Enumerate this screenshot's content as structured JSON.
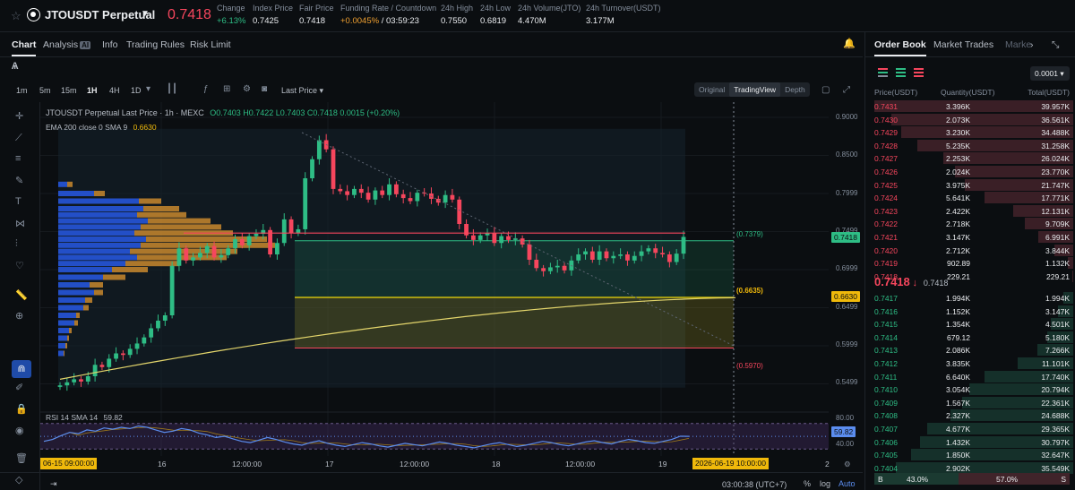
{
  "header": {
    "symbol": "JTOUSDT Perpetual",
    "last_price": "0.7418",
    "stats": [
      {
        "label": "Change",
        "value": "+6.13%",
        "tone": "green"
      },
      {
        "label": "Index Price",
        "value": "0.7425",
        "tone": ""
      },
      {
        "label": "Fair Price",
        "value": "0.7418",
        "tone": ""
      },
      {
        "label": "Funding Rate / Countdown",
        "value": "+0.0045%",
        "value2": " / 03:59:23",
        "tone": "orange"
      },
      {
        "label": "24h High",
        "value": "0.7550",
        "tone": ""
      },
      {
        "label": "24h Low",
        "value": "0.6819",
        "tone": ""
      },
      {
        "label": "24h Volume(JTO)",
        "value": "4.470M",
        "tone": ""
      },
      {
        "label": "24h Turnover(USDT)",
        "value": "3.177M",
        "tone": ""
      }
    ]
  },
  "tabs": {
    "chart": "Chart",
    "analysis": "Analysis",
    "analysis_badge": "AI",
    "info": "Info",
    "trading_rules": "Trading Rules",
    "risk_limit": "Risk Limit"
  },
  "toolbar": {
    "timeframes": [
      "1m",
      "5m",
      "15m",
      "1H",
      "4H",
      "1D"
    ],
    "active_timeframe": "1H",
    "price_source": "Last Price",
    "views": [
      "Original",
      "TradingView",
      "Depth"
    ],
    "active_view": "TradingView"
  },
  "chart": {
    "ohlc_title": "JTOUSDT Perpetual Last Price · 1h · MEXC",
    "ohlc_values": "O0.7403 H0.7422 L0.7403 C0.7418 0.0015 (+0.20%)",
    "ema_label": "EMA 200 close 0 SMA 9",
    "ema_value": "0.6630",
    "rsi_label": "RSI 14 SMA 14",
    "rsi_value": "59.82",
    "price_axis": [
      "0.9000",
      "0.8500",
      "0.7999",
      "0.7499",
      "0.6999",
      "0.6499",
      "0.5999",
      "0.5499"
    ],
    "price_tag_last": "0.7418",
    "price_tag_ema": "0.6630",
    "fib_levels": [
      {
        "label": "(0.7379)",
        "color": "#2ebd85"
      },
      {
        "label": "(0.6635)",
        "color": "#f0b90b"
      },
      {
        "label": "(0.5970)",
        "color": "#f6465d"
      }
    ],
    "rsi_axis": [
      "80.00",
      "40.00"
    ],
    "rsi_tag": "59.82",
    "time_axis": [
      "16",
      "12:00:00",
      "17",
      "12:00:00",
      "18",
      "12:00:00",
      "19"
    ],
    "time_tag_left": "06-15   09:00:00",
    "time_tag_right": "2026-06-19   10:00:00",
    "time_axis_end": "2"
  },
  "chart_data": {
    "type": "candlestick",
    "title": "JTOUSDT Perpetual Last Price · 1h · MEXC",
    "ylim": [
      0.52,
      0.92
    ],
    "close": [
      0.548,
      0.552,
      0.556,
      0.553,
      0.56,
      0.575,
      0.572,
      0.583,
      0.59,
      0.588,
      0.596,
      0.603,
      0.611,
      0.623,
      0.633,
      0.64,
      0.705,
      0.728,
      0.712,
      0.716,
      0.722,
      0.731,
      0.716,
      0.719,
      0.728,
      0.74,
      0.732,
      0.744,
      0.747,
      0.752,
      0.72,
      0.735,
      0.766,
      0.748,
      0.753,
      0.82,
      0.845,
      0.87,
      0.858,
      0.806,
      0.803,
      0.798,
      0.806,
      0.801,
      0.792,
      0.804,
      0.798,
      0.812,
      0.799,
      0.794,
      0.79,
      0.801,
      0.8,
      0.793,
      0.788,
      0.798,
      0.792,
      0.76,
      0.745,
      0.739,
      0.745,
      0.748,
      0.735,
      0.744,
      0.739,
      0.741,
      0.733,
      0.713,
      0.702,
      0.698,
      0.703,
      0.705,
      0.699,
      0.712,
      0.72,
      0.724,
      0.713,
      0.724,
      0.715,
      0.718,
      0.72,
      0.712,
      0.718,
      0.724,
      0.728,
      0.722,
      0.72,
      0.71,
      0.721,
      0.743
    ],
    "ema200": "rising from 0.556 to 0.663"
  },
  "order_book": {
    "tabs": [
      "Order Book",
      "Market Trades",
      "Marke"
    ],
    "precision": "0.0001",
    "columns": [
      "Price(USDT)",
      "Quantity(USDT)",
      "Total(USDT)"
    ],
    "asks": [
      {
        "price": "0.7431",
        "qty": "3.396K",
        "total": "39.957K"
      },
      {
        "price": "0.7430",
        "qty": "2.073K",
        "total": "36.561K"
      },
      {
        "price": "0.7429",
        "qty": "3.230K",
        "total": "34.488K"
      },
      {
        "price": "0.7428",
        "qty": "5.235K",
        "total": "31.258K"
      },
      {
        "price": "0.7427",
        "qty": "2.253K",
        "total": "26.024K"
      },
      {
        "price": "0.7426",
        "qty": "2.024K",
        "total": "23.770K"
      },
      {
        "price": "0.7425",
        "qty": "3.975K",
        "total": "21.747K"
      },
      {
        "price": "0.7424",
        "qty": "5.641K",
        "total": "17.771K"
      },
      {
        "price": "0.7423",
        "qty": "2.422K",
        "total": "12.131K"
      },
      {
        "price": "0.7422",
        "qty": "2.718K",
        "total": "9.709K"
      },
      {
        "price": "0.7421",
        "qty": "3.147K",
        "total": "6.991K"
      },
      {
        "price": "0.7420",
        "qty": "2.712K",
        "total": "3.844K"
      },
      {
        "price": "0.7419",
        "qty": "902.89",
        "total": "1.132K"
      },
      {
        "price": "0.7418",
        "qty": "229.21",
        "total": "229.21"
      }
    ],
    "mid_price": "0.7418",
    "mid_arrow": "↓",
    "mark_price": "0.7418",
    "bids": [
      {
        "price": "0.7417",
        "qty": "1.994K",
        "total": "1.994K"
      },
      {
        "price": "0.7416",
        "qty": "1.152K",
        "total": "3.147K"
      },
      {
        "price": "0.7415",
        "qty": "1.354K",
        "total": "4.501K"
      },
      {
        "price": "0.7414",
        "qty": "679.12",
        "total": "5.180K"
      },
      {
        "price": "0.7413",
        "qty": "2.086K",
        "total": "7.266K"
      },
      {
        "price": "0.7412",
        "qty": "3.835K",
        "total": "11.101K"
      },
      {
        "price": "0.7411",
        "qty": "6.640K",
        "total": "17.740K"
      },
      {
        "price": "0.7410",
        "qty": "3.054K",
        "total": "20.794K"
      },
      {
        "price": "0.7409",
        "qty": "1.567K",
        "total": "22.361K"
      },
      {
        "price": "0.7408",
        "qty": "2.327K",
        "total": "24.688K"
      },
      {
        "price": "0.7407",
        "qty": "4.677K",
        "total": "29.365K"
      },
      {
        "price": "0.7406",
        "qty": "1.432K",
        "total": "30.797K"
      },
      {
        "price": "0.7405",
        "qty": "1.850K",
        "total": "32.647K"
      },
      {
        "price": "0.7404",
        "qty": "2.902K",
        "total": "35.549K"
      }
    ],
    "buy_label": "B",
    "buy_ratio": "43.0%",
    "sell_ratio": "57.0%",
    "sell_label": "S",
    "buy_fraction": 0.43
  },
  "footer": {
    "clock": "03:00:38 (UTC+7)",
    "percent": "%",
    "log": "log",
    "auto": "Auto"
  },
  "colors": {
    "up": "#2ebd85",
    "down": "#f6465d",
    "accent": "#f0b90b",
    "volume_profile_blue": "#2962ff",
    "volume_profile_orange": "#f0a030"
  }
}
